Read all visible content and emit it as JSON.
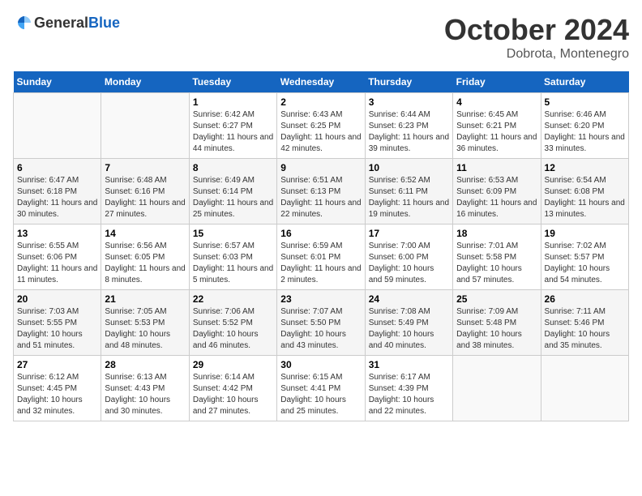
{
  "header": {
    "logo": {
      "general": "General",
      "blue": "Blue"
    },
    "title": "October 2024",
    "location": "Dobrota, Montenegro"
  },
  "calendar": {
    "days_of_week": [
      "Sunday",
      "Monday",
      "Tuesday",
      "Wednesday",
      "Thursday",
      "Friday",
      "Saturday"
    ],
    "weeks": [
      [
        {
          "day": null,
          "info": null
        },
        {
          "day": null,
          "info": null
        },
        {
          "day": "1",
          "info": "Sunrise: 6:42 AM\nSunset: 6:27 PM\nDaylight: 11 hours and 44 minutes."
        },
        {
          "day": "2",
          "info": "Sunrise: 6:43 AM\nSunset: 6:25 PM\nDaylight: 11 hours and 42 minutes."
        },
        {
          "day": "3",
          "info": "Sunrise: 6:44 AM\nSunset: 6:23 PM\nDaylight: 11 hours and 39 minutes."
        },
        {
          "day": "4",
          "info": "Sunrise: 6:45 AM\nSunset: 6:21 PM\nDaylight: 11 hours and 36 minutes."
        },
        {
          "day": "5",
          "info": "Sunrise: 6:46 AM\nSunset: 6:20 PM\nDaylight: 11 hours and 33 minutes."
        }
      ],
      [
        {
          "day": "6",
          "info": "Sunrise: 6:47 AM\nSunset: 6:18 PM\nDaylight: 11 hours and 30 minutes."
        },
        {
          "day": "7",
          "info": "Sunrise: 6:48 AM\nSunset: 6:16 PM\nDaylight: 11 hours and 27 minutes."
        },
        {
          "day": "8",
          "info": "Sunrise: 6:49 AM\nSunset: 6:14 PM\nDaylight: 11 hours and 25 minutes."
        },
        {
          "day": "9",
          "info": "Sunrise: 6:51 AM\nSunset: 6:13 PM\nDaylight: 11 hours and 22 minutes."
        },
        {
          "day": "10",
          "info": "Sunrise: 6:52 AM\nSunset: 6:11 PM\nDaylight: 11 hours and 19 minutes."
        },
        {
          "day": "11",
          "info": "Sunrise: 6:53 AM\nSunset: 6:09 PM\nDaylight: 11 hours and 16 minutes."
        },
        {
          "day": "12",
          "info": "Sunrise: 6:54 AM\nSunset: 6:08 PM\nDaylight: 11 hours and 13 minutes."
        }
      ],
      [
        {
          "day": "13",
          "info": "Sunrise: 6:55 AM\nSunset: 6:06 PM\nDaylight: 11 hours and 11 minutes."
        },
        {
          "day": "14",
          "info": "Sunrise: 6:56 AM\nSunset: 6:05 PM\nDaylight: 11 hours and 8 minutes."
        },
        {
          "day": "15",
          "info": "Sunrise: 6:57 AM\nSunset: 6:03 PM\nDaylight: 11 hours and 5 minutes."
        },
        {
          "day": "16",
          "info": "Sunrise: 6:59 AM\nSunset: 6:01 PM\nDaylight: 11 hours and 2 minutes."
        },
        {
          "day": "17",
          "info": "Sunrise: 7:00 AM\nSunset: 6:00 PM\nDaylight: 10 hours and 59 minutes."
        },
        {
          "day": "18",
          "info": "Sunrise: 7:01 AM\nSunset: 5:58 PM\nDaylight: 10 hours and 57 minutes."
        },
        {
          "day": "19",
          "info": "Sunrise: 7:02 AM\nSunset: 5:57 PM\nDaylight: 10 hours and 54 minutes."
        }
      ],
      [
        {
          "day": "20",
          "info": "Sunrise: 7:03 AM\nSunset: 5:55 PM\nDaylight: 10 hours and 51 minutes."
        },
        {
          "day": "21",
          "info": "Sunrise: 7:05 AM\nSunset: 5:53 PM\nDaylight: 10 hours and 48 minutes."
        },
        {
          "day": "22",
          "info": "Sunrise: 7:06 AM\nSunset: 5:52 PM\nDaylight: 10 hours and 46 minutes."
        },
        {
          "day": "23",
          "info": "Sunrise: 7:07 AM\nSunset: 5:50 PM\nDaylight: 10 hours and 43 minutes."
        },
        {
          "day": "24",
          "info": "Sunrise: 7:08 AM\nSunset: 5:49 PM\nDaylight: 10 hours and 40 minutes."
        },
        {
          "day": "25",
          "info": "Sunrise: 7:09 AM\nSunset: 5:48 PM\nDaylight: 10 hours and 38 minutes."
        },
        {
          "day": "26",
          "info": "Sunrise: 7:11 AM\nSunset: 5:46 PM\nDaylight: 10 hours and 35 minutes."
        }
      ],
      [
        {
          "day": "27",
          "info": "Sunrise: 6:12 AM\nSunset: 4:45 PM\nDaylight: 10 hours and 32 minutes."
        },
        {
          "day": "28",
          "info": "Sunrise: 6:13 AM\nSunset: 4:43 PM\nDaylight: 10 hours and 30 minutes."
        },
        {
          "day": "29",
          "info": "Sunrise: 6:14 AM\nSunset: 4:42 PM\nDaylight: 10 hours and 27 minutes."
        },
        {
          "day": "30",
          "info": "Sunrise: 6:15 AM\nSunset: 4:41 PM\nDaylight: 10 hours and 25 minutes."
        },
        {
          "day": "31",
          "info": "Sunrise: 6:17 AM\nSunset: 4:39 PM\nDaylight: 10 hours and 22 minutes."
        },
        {
          "day": null,
          "info": null
        },
        {
          "day": null,
          "info": null
        }
      ]
    ]
  }
}
